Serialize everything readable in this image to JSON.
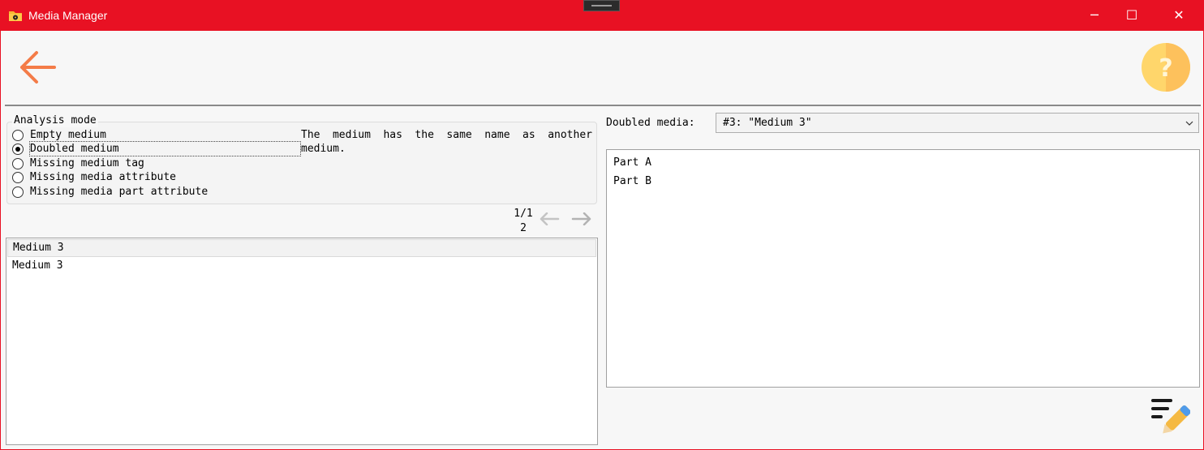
{
  "window": {
    "title": "Media Manager",
    "app_icon": "folder-icon",
    "minimize_glyph": "─",
    "maximize_glyph": "☐",
    "close_glyph": "✕"
  },
  "toolbar": {
    "back_icon": "arrow-left-icon",
    "help_icon": "help-icon",
    "back_color": "#f47c48",
    "help_color": "#ffd66b"
  },
  "analysis": {
    "group_label": "Analysis mode",
    "options": [
      {
        "label": "Empty medium",
        "checked": false
      },
      {
        "label": "Doubled medium",
        "checked": true
      },
      {
        "label": "Missing medium tag",
        "checked": false
      },
      {
        "label": "Missing media attribute",
        "checked": false
      },
      {
        "label": "Missing media part attribute",
        "checked": false
      }
    ],
    "description": "The medium has the same name as another medium."
  },
  "pager": {
    "line1": "1/1",
    "line2": "2",
    "prev_icon": "arrow-left-icon",
    "next_icon": "arrow-right-icon"
  },
  "results": {
    "items": [
      "Medium 3",
      "Medium 3"
    ]
  },
  "doubled": {
    "label": "Doubled media:",
    "selected": "#3: \"Medium 3\"",
    "parts": [
      "Part A",
      "Part B"
    ]
  },
  "footer": {
    "edit_icon": "edit-notes-icon"
  },
  "colors": {
    "titlebar": "#e81123",
    "background": "#f7f7f7"
  }
}
